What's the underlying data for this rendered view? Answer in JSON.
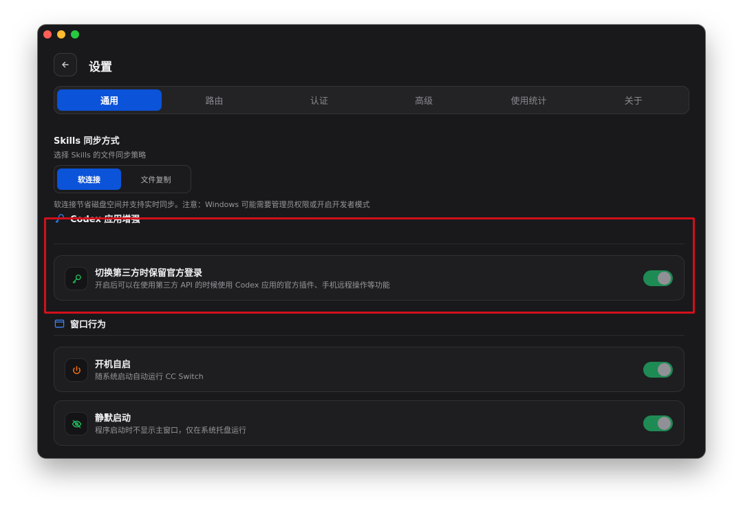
{
  "header": {
    "title": "设置"
  },
  "tabs": [
    {
      "label": "通用",
      "active": true
    },
    {
      "label": "路由",
      "active": false
    },
    {
      "label": "认证",
      "active": false
    },
    {
      "label": "高级",
      "active": false
    },
    {
      "label": "使用统计",
      "active": false
    },
    {
      "label": "关于",
      "active": false
    }
  ],
  "skills": {
    "title": "Skills 同步方式",
    "subtitle": "选择 Skills 的文件同步策略",
    "options": [
      {
        "label": "软连接",
        "selected": true
      },
      {
        "label": "文件复制",
        "selected": false
      }
    ],
    "note": "软连接节省磁盘空间并支持实时同步。注意：Windows 可能需要管理员权限或开启开发者模式"
  },
  "codex": {
    "section_title": "Codex 应用增强",
    "item": {
      "title": "切换第三方时保留官方登录",
      "desc": "开启后可以在使用第三方 API 的时候使用 Codex 应用的官方插件、手机远程操作等功能",
      "enabled": true
    }
  },
  "window_behavior": {
    "section_title": "窗口行为",
    "items": [
      {
        "title": "开机自启",
        "desc": "随系统启动自动运行 CC Switch",
        "enabled": true
      },
      {
        "title": "静默启动",
        "desc": "程序启动时不显示主窗口，仅在系统托盘运行",
        "enabled": true
      }
    ]
  },
  "colors": {
    "accent": "#0b53d9",
    "toggle_on": "#1f8b54",
    "highlight": "#d3101a",
    "window_bg": "#19191b"
  },
  "icons": {
    "back": "arrow-left-icon",
    "codex_section": "key-icon",
    "codex_item": "key-icon",
    "window_section": "app-window-icon",
    "autostart": "power-icon",
    "silent": "eye-off-icon"
  }
}
